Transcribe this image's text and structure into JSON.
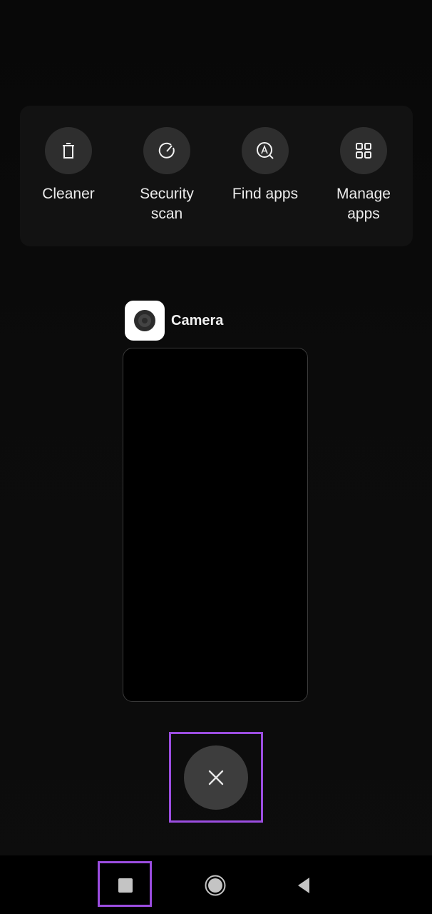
{
  "quick_tools": [
    {
      "label": "Cleaner",
      "icon": "trash-icon"
    },
    {
      "label": "Security\nscan",
      "icon": "security-scan-icon"
    },
    {
      "label": "Find apps",
      "icon": "find-apps-icon"
    },
    {
      "label": "Manage\napps",
      "icon": "manage-apps-icon"
    }
  ],
  "recent_app": {
    "name": "Camera",
    "icon": "camera-icon"
  },
  "close_all": {
    "icon": "close-icon"
  },
  "highlight_color": "#9b4de0",
  "navbar": {
    "recents": "recents-icon",
    "home": "home-icon",
    "back": "back-icon"
  }
}
